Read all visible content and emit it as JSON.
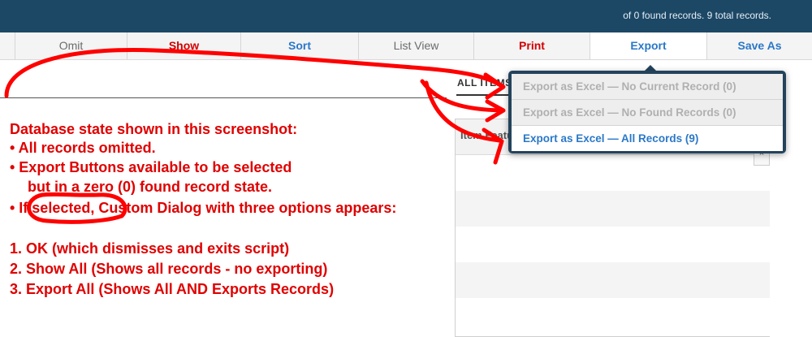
{
  "header": {
    "record_status": "of 0 found records. 9 total records."
  },
  "toolbar": {
    "omit": "Omit",
    "show": "Show",
    "sort": "Sort",
    "list_view": "List View",
    "print": "Print",
    "export": "Export",
    "save_as": "Save As"
  },
  "tabs": {
    "all_items": "ALL ITEMS"
  },
  "panel": {
    "header": "Item Features"
  },
  "export_menu": {
    "items": [
      {
        "label": "Export as Excel — No Current Record (0)",
        "enabled": false
      },
      {
        "label": "Export as Excel — No Found Records (0)",
        "enabled": false
      },
      {
        "label": "Export as Excel — All Records (9)",
        "enabled": true
      }
    ]
  },
  "annotation": {
    "heading": "Database state shown in this screenshot:",
    "bullet1": "• All records omitted.",
    "bullet2a": "• Export Buttons available to be selected",
    "bullet2b": "but in a zero (0) found record state.",
    "bullet3": "• If selected, Custom Dialog with three options appears:",
    "option1": "1. OK (which dismisses and exits script)",
    "option2": "2. Show All (Shows all records - no exporting)",
    "option3": "3. Export All (Shows All AND Exports Records)"
  },
  "colors": {
    "header_bg": "#1c4866",
    "annotation_red": "#e00000",
    "link_blue": "#2a78c8",
    "toolbar_red": "#d20000"
  }
}
